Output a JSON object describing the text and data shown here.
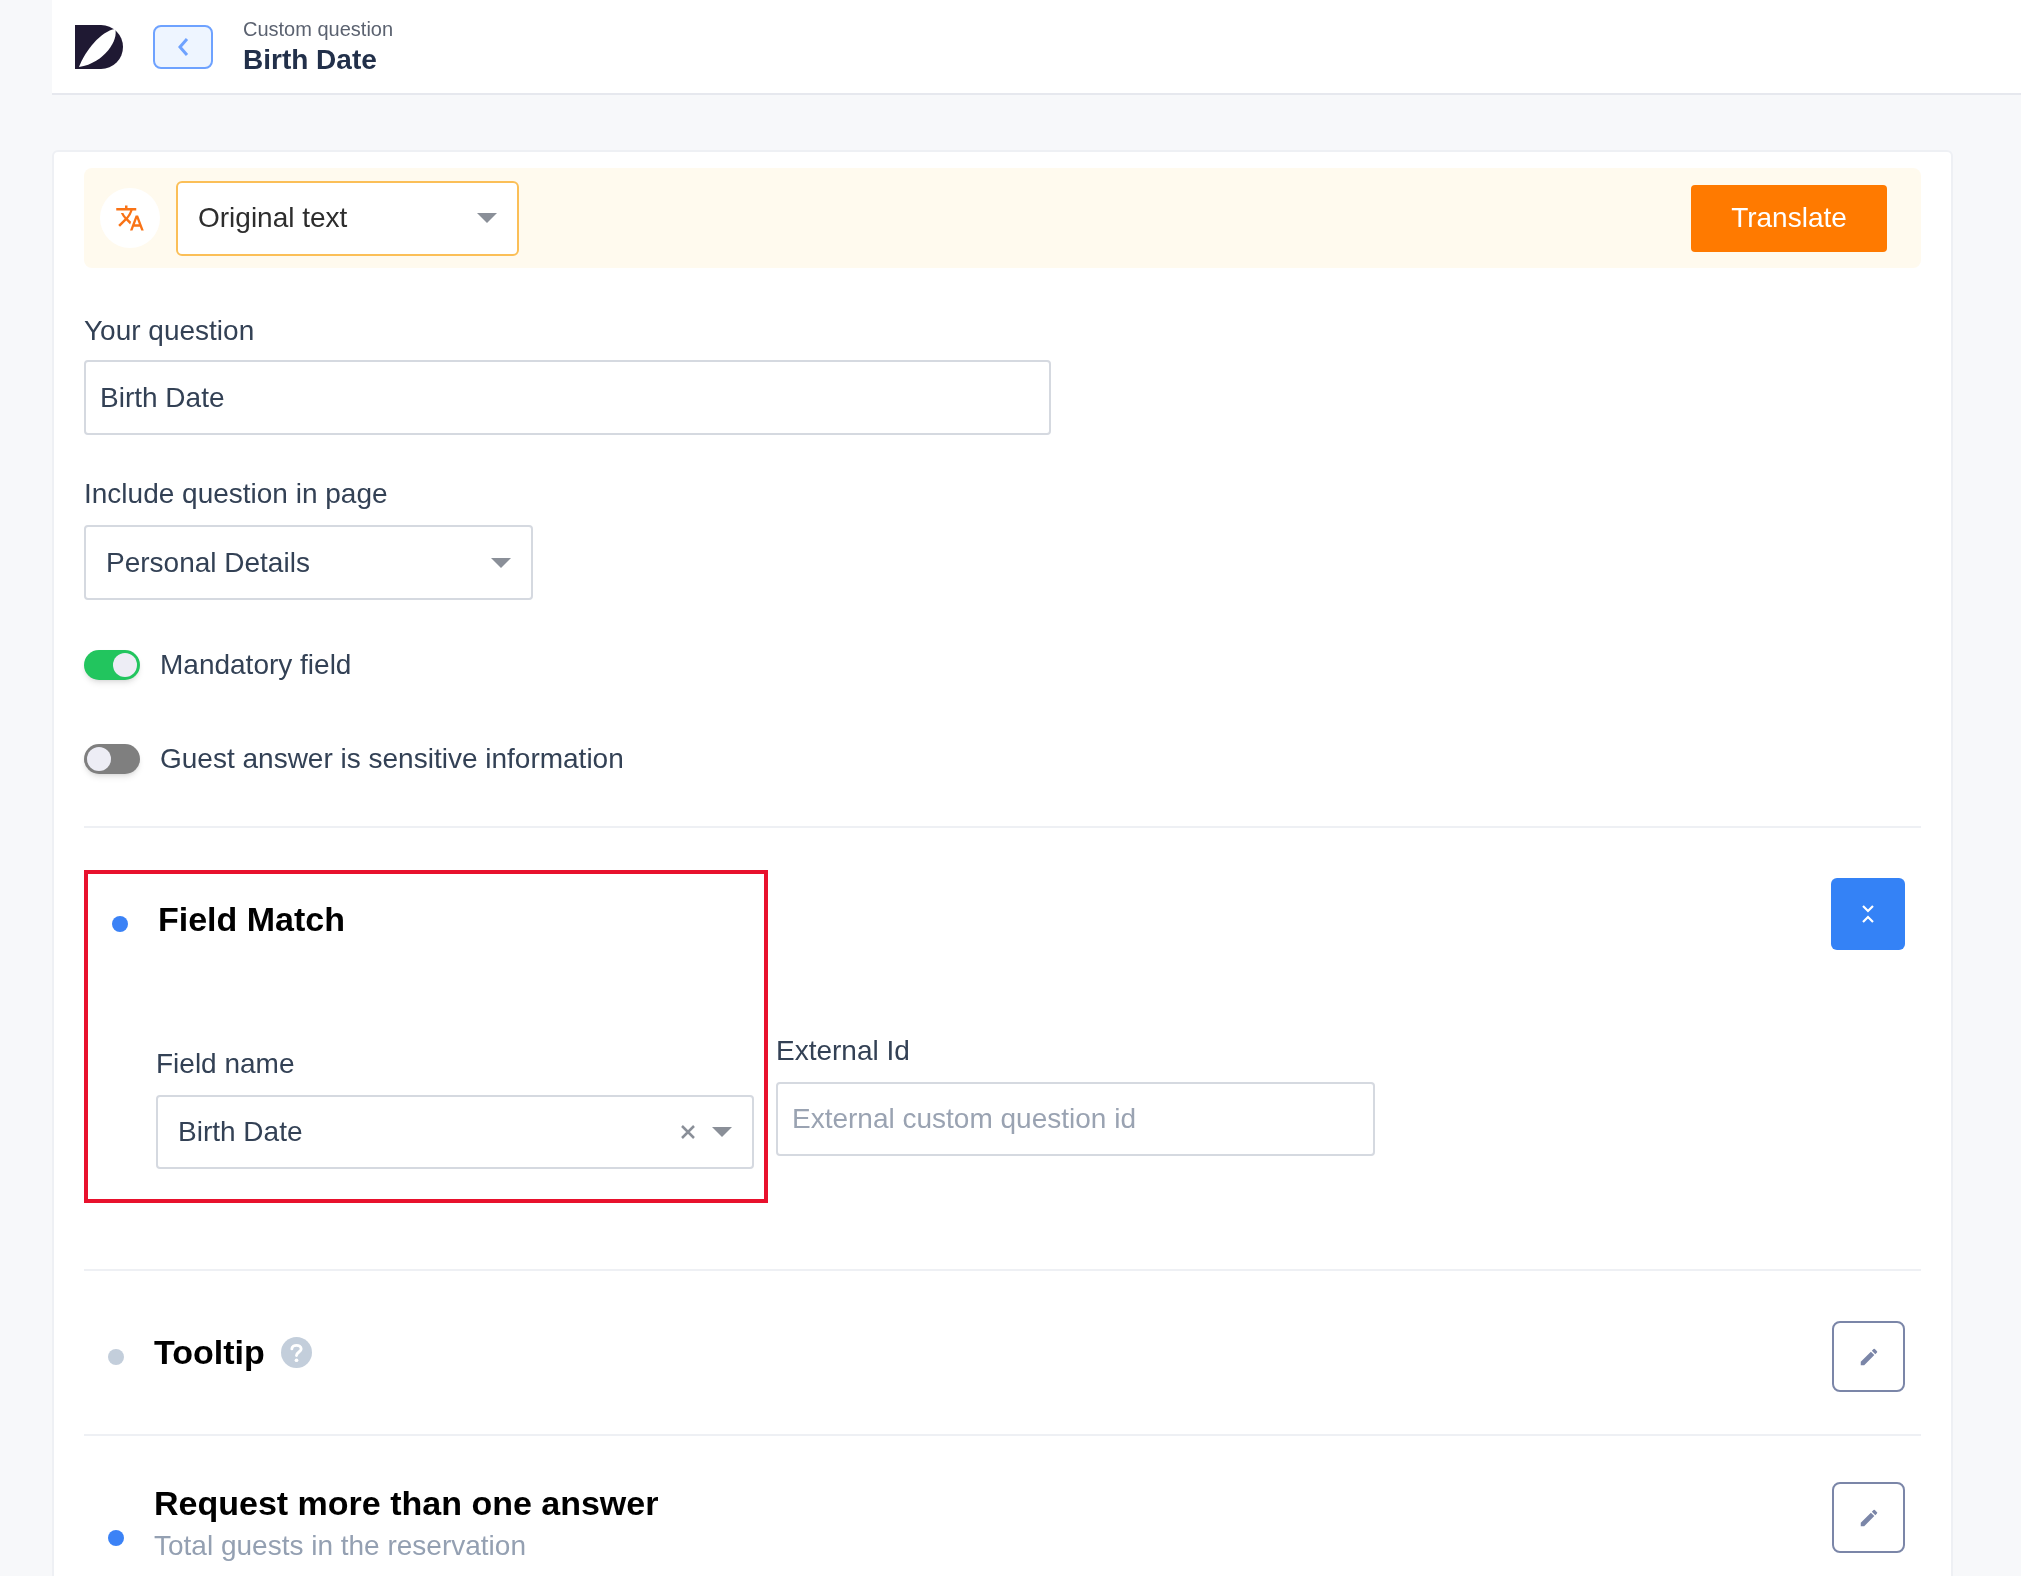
{
  "header": {
    "subtitle": "Custom question",
    "title": "Birth Date"
  },
  "translate_bar": {
    "language": "Original text",
    "button": "Translate"
  },
  "question": {
    "label": "Your question",
    "value": "Birth Date"
  },
  "page_select": {
    "label": "Include question in page",
    "value": "Personal Details"
  },
  "toggles": [
    {
      "label": "Mandatory field",
      "on": true
    },
    {
      "label": "Guest answer is sensitive information",
      "on": false
    }
  ],
  "sections": [
    {
      "title": "Field Match",
      "color": "#3b82f6",
      "expanded": true,
      "highlighted": true,
      "help": false,
      "fields": [
        {
          "kind": "select",
          "label": "Field name",
          "value": "Birth Date"
        },
        {
          "kind": "text",
          "label": "External Id",
          "placeholder": "External custom question id"
        }
      ]
    },
    {
      "title": "Tooltip",
      "color": "#c3cedb",
      "expanded": false,
      "highlighted": false,
      "help": true
    },
    {
      "title": "Request more than one answer",
      "subtitle": "Total guests in the reservation",
      "color": "#3b82f6",
      "expanded": false,
      "highlighted": false,
      "help": false
    }
  ]
}
